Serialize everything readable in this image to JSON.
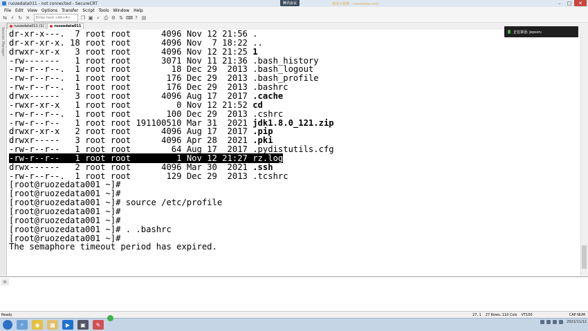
{
  "window": {
    "title": "ruozedata011 - not connected - SecureCRT",
    "minimize": "–",
    "maximize": "□",
    "close": "✕"
  },
  "overlay": {
    "meeting_label": "腾讯会议",
    "watermark": "若泽大数据 · ruozedata.com",
    "speaking_label": "正在讲话: Jepson;"
  },
  "menu": [
    "File",
    "Edit",
    "View",
    "Options",
    "Transfer",
    "Script",
    "Tools",
    "Window",
    "Help"
  ],
  "toolbar": {
    "host_placeholder": "Enter host <Alt+R>"
  },
  "tabs": [
    {
      "label": "ruozedata011 (1)",
      "active": false
    },
    {
      "label": "ruozedata011",
      "active": true
    }
  ],
  "side_panel": {
    "label": "Session Manager"
  },
  "listing": [
    {
      "attrs": "dr-xr-x---.",
      "links": "7",
      "owner": "root",
      "group": "root",
      "size": "4096",
      "month": "Nov",
      "day": "12",
      "time": "21:56",
      "name": ".",
      "bold": false
    },
    {
      "attrs": "dr-xr-xr-x.",
      "links": "18",
      "owner": "root",
      "group": "root",
      "size": "4096",
      "month": "Nov",
      "day": "7",
      "time": "18:22",
      "name": "..",
      "bold": false
    },
    {
      "attrs": "drwxr-xr-x",
      "links": "3",
      "owner": "root",
      "group": "root",
      "size": "4096",
      "month": "Nov",
      "day": "12",
      "time": "21:25",
      "name": "1",
      "bold": true
    },
    {
      "attrs": "-rw-------",
      "links": "1",
      "owner": "root",
      "group": "root",
      "size": "3071",
      "month": "Nov",
      "day": "11",
      "time": "21:36",
      "name": ".bash_history",
      "bold": false
    },
    {
      "attrs": "-rw-r--r--.",
      "links": "1",
      "owner": "root",
      "group": "root",
      "size": "18",
      "month": "Dec",
      "day": "29",
      "time": "2013",
      "name": ".bash_logout",
      "bold": false
    },
    {
      "attrs": "-rw-r--r--.",
      "links": "1",
      "owner": "root",
      "group": "root",
      "size": "176",
      "month": "Dec",
      "day": "29",
      "time": "2013",
      "name": ".bash_profile",
      "bold": false
    },
    {
      "attrs": "-rw-r--r--.",
      "links": "1",
      "owner": "root",
      "group": "root",
      "size": "176",
      "month": "Dec",
      "day": "29",
      "time": "2013",
      "name": ".bashrc",
      "bold": false
    },
    {
      "attrs": "drwx------",
      "links": "3",
      "owner": "root",
      "group": "root",
      "size": "4096",
      "month": "Aug",
      "day": "17",
      "time": "2017",
      "name": ".cache",
      "bold": true
    },
    {
      "attrs": "-rwxr-xr-x",
      "links": "1",
      "owner": "root",
      "group": "root",
      "size": "0",
      "month": "Nov",
      "day": "12",
      "time": "21:52",
      "name": "cd",
      "bold": true
    },
    {
      "attrs": "-rw-r--r--.",
      "links": "1",
      "owner": "root",
      "group": "root",
      "size": "100",
      "month": "Dec",
      "day": "29",
      "time": "2013",
      "name": ".cshrc",
      "bold": false
    },
    {
      "attrs": "-rw-r--r--",
      "links": "1",
      "owner": "root",
      "group": "root",
      "size": "191100510",
      "month": "Mar",
      "day": "31",
      "time": "2021",
      "name": "jdk1.8.0_121.zip",
      "bold": true
    },
    {
      "attrs": "drwxr-xr-x",
      "links": "2",
      "owner": "root",
      "group": "root",
      "size": "4096",
      "month": "Aug",
      "day": "17",
      "time": "2017",
      "name": ".pip",
      "bold": true
    },
    {
      "attrs": "drwxr-----",
      "links": "3",
      "owner": "root",
      "group": "root",
      "size": "4096",
      "month": "Apr",
      "day": "28",
      "time": "2021",
      "name": ".pki",
      "bold": true
    },
    {
      "attrs": "-rw-r--r--",
      "links": "1",
      "owner": "root",
      "group": "root",
      "size": "64",
      "month": "Aug",
      "day": "17",
      "time": "2017",
      "name": ".pydistutils.cfg",
      "bold": false
    },
    {
      "attrs": "-rw-r--r--",
      "links": "1",
      "owner": "root",
      "group": "root",
      "size": "1",
      "month": "Nov",
      "day": "12",
      "time": "21:27",
      "name": "rz.log",
      "bold": false,
      "selected": true
    },
    {
      "attrs": "drwx------",
      "links": "2",
      "owner": "root",
      "group": "root",
      "size": "4096",
      "month": "Mar",
      "day": "30",
      "time": "2021",
      "name": ".ssh",
      "bold": true
    },
    {
      "attrs": "-rw-r--r--.",
      "links": "1",
      "owner": "root",
      "group": "root",
      "size": "129",
      "month": "Dec",
      "day": "29",
      "time": "2013",
      "name": ".tcshrc",
      "bold": false
    }
  ],
  "console": [
    "[root@ruozedata001 ~]#",
    "[root@ruozedata001 ~]#",
    "[root@ruozedata001 ~]# source /etc/profile",
    "[root@ruozedata001 ~]#",
    "[root@ruozedata001 ~]#",
    "[root@ruozedata001 ~]# . .bashrc",
    "[root@ruozedata001 ~]#",
    "The semaphore timeout period has expired."
  ],
  "statusbar": {
    "left": "Ready",
    "position": "27,  1",
    "size": "27 Rows, 110 Cols",
    "term": "VT100",
    "caps": "CAP NUM"
  },
  "taskbar": {
    "clock": "2021/11/12"
  },
  "colors": {
    "accent": "#2a72c6",
    "selection_bg": "#000000",
    "close_red": "#c9463d"
  }
}
